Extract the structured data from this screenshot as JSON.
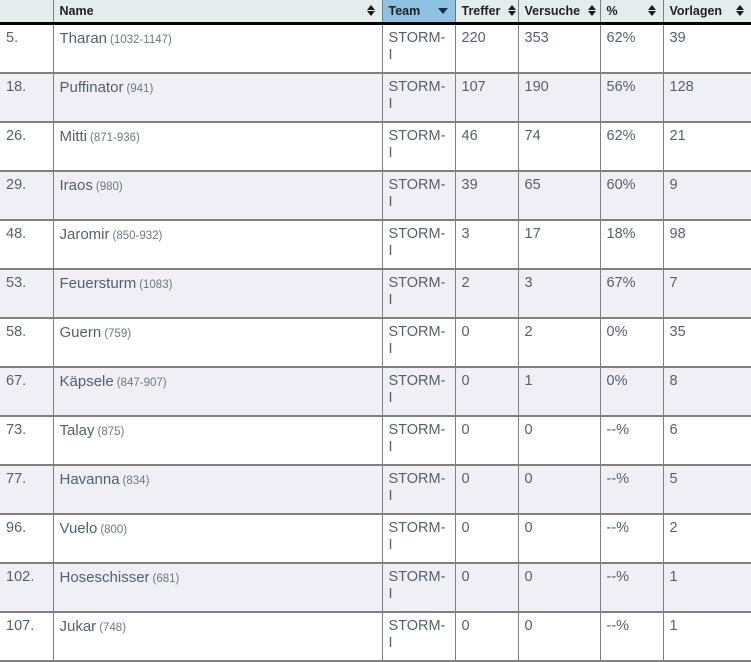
{
  "table": {
    "columns": [
      {
        "key": "rank",
        "label": "",
        "sort": "none",
        "active": false
      },
      {
        "key": "name",
        "label": "Name",
        "sort": "both",
        "active": false
      },
      {
        "key": "team",
        "label": "Team",
        "sort": "desc",
        "active": true
      },
      {
        "key": "treffer",
        "label": "Treffer",
        "sort": "both",
        "active": false
      },
      {
        "key": "versuche",
        "label": "Versuche",
        "sort": "both",
        "active": false
      },
      {
        "key": "percent",
        "label": "%",
        "sort": "both",
        "active": false
      },
      {
        "key": "vorlagen",
        "label": "Vorlagen",
        "sort": "both",
        "active": false
      }
    ],
    "rows": [
      {
        "rank": "5.",
        "name": "Tharan",
        "range": "(1032-1147)",
        "team": "STORM-I",
        "treffer": "220",
        "versuche": "353",
        "percent": "62%",
        "vorlagen": "39"
      },
      {
        "rank": "18.",
        "name": "Puffinator",
        "range": "(941)",
        "team": "STORM-I",
        "treffer": "107",
        "versuche": "190",
        "percent": "56%",
        "vorlagen": "128"
      },
      {
        "rank": "26.",
        "name": "Mitti",
        "range": "(871-936)",
        "team": "STORM-I",
        "treffer": "46",
        "versuche": "74",
        "percent": "62%",
        "vorlagen": "21"
      },
      {
        "rank": "29.",
        "name": "Iraos",
        "range": "(980)",
        "team": "STORM-I",
        "treffer": "39",
        "versuche": "65",
        "percent": "60%",
        "vorlagen": "9"
      },
      {
        "rank": "48.",
        "name": "Jaromir",
        "range": "(850-932)",
        "team": "STORM-I",
        "treffer": "3",
        "versuche": "17",
        "percent": "18%",
        "vorlagen": "98"
      },
      {
        "rank": "53.",
        "name": "Feuersturm",
        "range": "(1083)",
        "team": "STORM-I",
        "treffer": "2",
        "versuche": "3",
        "percent": "67%",
        "vorlagen": "7"
      },
      {
        "rank": "58.",
        "name": "Guern",
        "range": "(759)",
        "team": "STORM-I",
        "treffer": "0",
        "versuche": "2",
        "percent": "0%",
        "vorlagen": "35"
      },
      {
        "rank": "67.",
        "name": "Käpsele",
        "range": "(847-907)",
        "team": "STORM-I",
        "treffer": "0",
        "versuche": "1",
        "percent": "0%",
        "vorlagen": "8"
      },
      {
        "rank": "73.",
        "name": "Talay",
        "range": "(875)",
        "team": "STORM-I",
        "treffer": "0",
        "versuche": "0",
        "percent": "--%",
        "vorlagen": "6"
      },
      {
        "rank": "77.",
        "name": "Havanna",
        "range": "(834)",
        "team": "STORM-I",
        "treffer": "0",
        "versuche": "0",
        "percent": "--%",
        "vorlagen": "5"
      },
      {
        "rank": "96.",
        "name": "Vuelo",
        "range": "(800)",
        "team": "STORM-I",
        "treffer": "0",
        "versuche": "0",
        "percent": "--%",
        "vorlagen": "2"
      },
      {
        "rank": "102.",
        "name": "Hoseschisser",
        "range": "(681)",
        "team": "STORM-I",
        "treffer": "0",
        "versuche": "0",
        "percent": "--%",
        "vorlagen": "1"
      },
      {
        "rank": "107.",
        "name": "Jukar",
        "range": "(748)",
        "team": "STORM-I",
        "treffer": "0",
        "versuche": "0",
        "percent": "--%",
        "vorlagen": "1"
      }
    ]
  },
  "colors": {
    "header_bg": "#e4ecec",
    "sorted_header_bg": "#8fc1e3",
    "row_odd_bg": "#ffffff",
    "row_even_bg": "#f0eff5",
    "border": "#808080",
    "text": "#555f6b"
  }
}
